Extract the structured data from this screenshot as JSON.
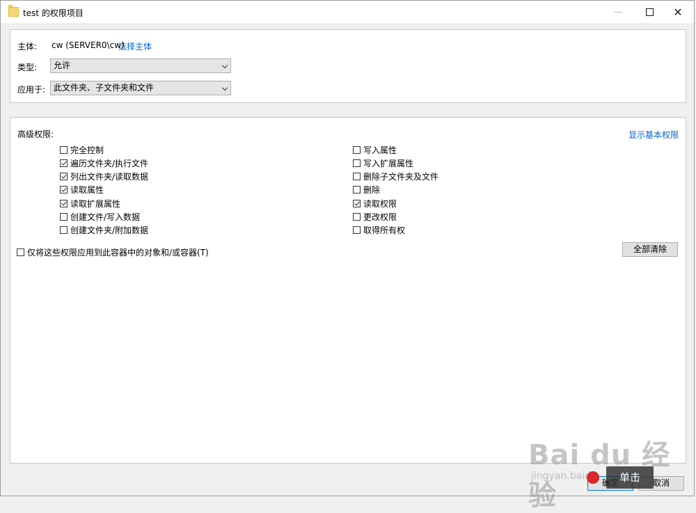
{
  "window": {
    "title": "test 的权限项目",
    "min_glyph": "—",
    "close_glyph": "✕"
  },
  "principal": {
    "label": "主体:",
    "value": "cw (SERVER0\\cw)",
    "select_link": "选择主体"
  },
  "type": {
    "label": "类型:",
    "selected": "允许"
  },
  "applies_to": {
    "label": "应用于:",
    "selected": "此文件夹、子文件夹和文件"
  },
  "advanced": {
    "label": "高级权限:",
    "show_basic_link": "显示基本权限",
    "left_permissions": [
      {
        "label": "完全控制",
        "checked": false
      },
      {
        "label": "遍历文件夹/执行文件",
        "checked": true
      },
      {
        "label": "列出文件夹/读取数据",
        "checked": true
      },
      {
        "label": "读取属性",
        "checked": true
      },
      {
        "label": "读取扩展属性",
        "checked": true
      },
      {
        "label": "创建文件/写入数据",
        "checked": false
      },
      {
        "label": "创建文件夹/附加数据",
        "checked": false
      }
    ],
    "right_permissions": [
      {
        "label": "写入属性",
        "checked": false
      },
      {
        "label": "写入扩展属性",
        "checked": false
      },
      {
        "label": "删除子文件夹及文件",
        "checked": false
      },
      {
        "label": "删除",
        "checked": false
      },
      {
        "label": "读取权限",
        "checked": true
      },
      {
        "label": "更改权限",
        "checked": false
      },
      {
        "label": "取得所有权",
        "checked": false
      }
    ],
    "apply_container_only": {
      "label": "仅将这些权限应用到此容器中的对象和/或容器(T)",
      "checked": false
    },
    "clear_all": "全部清除"
  },
  "footer": {
    "ok": "确定",
    "cancel": "取消"
  },
  "watermark": {
    "main": "Bai du 经验",
    "sub": "jingyan.baidu",
    "badge": "单击"
  }
}
